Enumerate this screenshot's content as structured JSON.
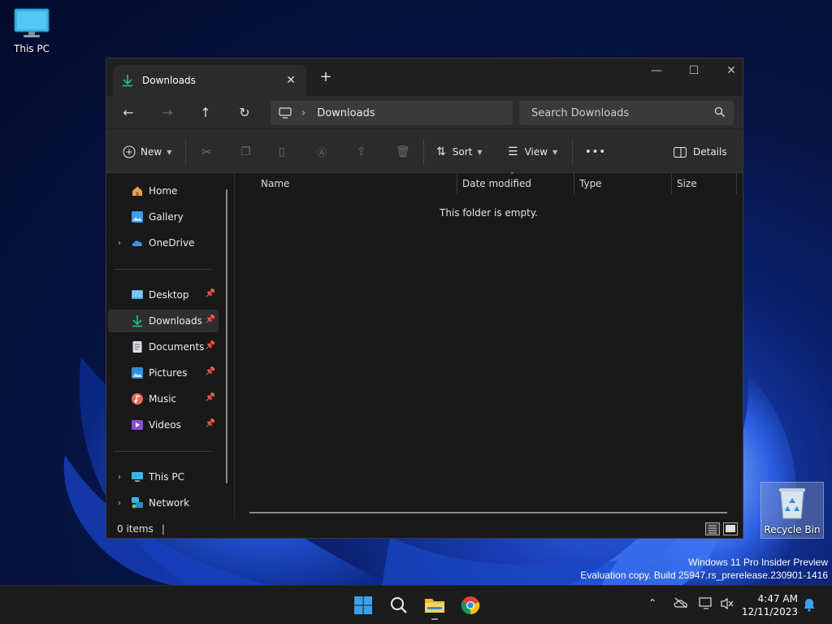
{
  "desktop": {
    "this_pc_label": "This PC",
    "recycle_bin_label": "Recycle Bin"
  },
  "window": {
    "tab_title": "Downloads",
    "new_tab_symbol": "+",
    "breadcrumb": {
      "location": "Downloads"
    },
    "search_placeholder": "Search Downloads",
    "toolbar": {
      "new_label": "New",
      "sort_label": "Sort",
      "view_label": "View",
      "more_label": "•••",
      "details_label": "Details"
    },
    "sidebar": {
      "home": "Home",
      "gallery": "Gallery",
      "onedrive": "OneDrive",
      "desktop": "Desktop",
      "downloads": "Downloads",
      "documents": "Documents",
      "pictures": "Pictures",
      "music": "Music",
      "videos": "Videos",
      "this_pc": "This PC",
      "network": "Network"
    },
    "columns": {
      "name": "Name",
      "date_modified": "Date modified",
      "type": "Type",
      "size": "Size"
    },
    "empty_message": "This folder is empty.",
    "status": {
      "items": "0 items",
      "caret": "|"
    }
  },
  "watermark": {
    "line1": "Windows 11 Pro Insider Preview",
    "line2": "Evaluation copy. Build 25947.rs_prerelease.230901-1416"
  },
  "taskbar": {
    "time": "4:47 AM",
    "date": "12/11/2023"
  },
  "colors": {
    "accent_green": "#1fbf8f",
    "window_bg": "#191919",
    "taskbar_bg": "#1c1c1c"
  }
}
